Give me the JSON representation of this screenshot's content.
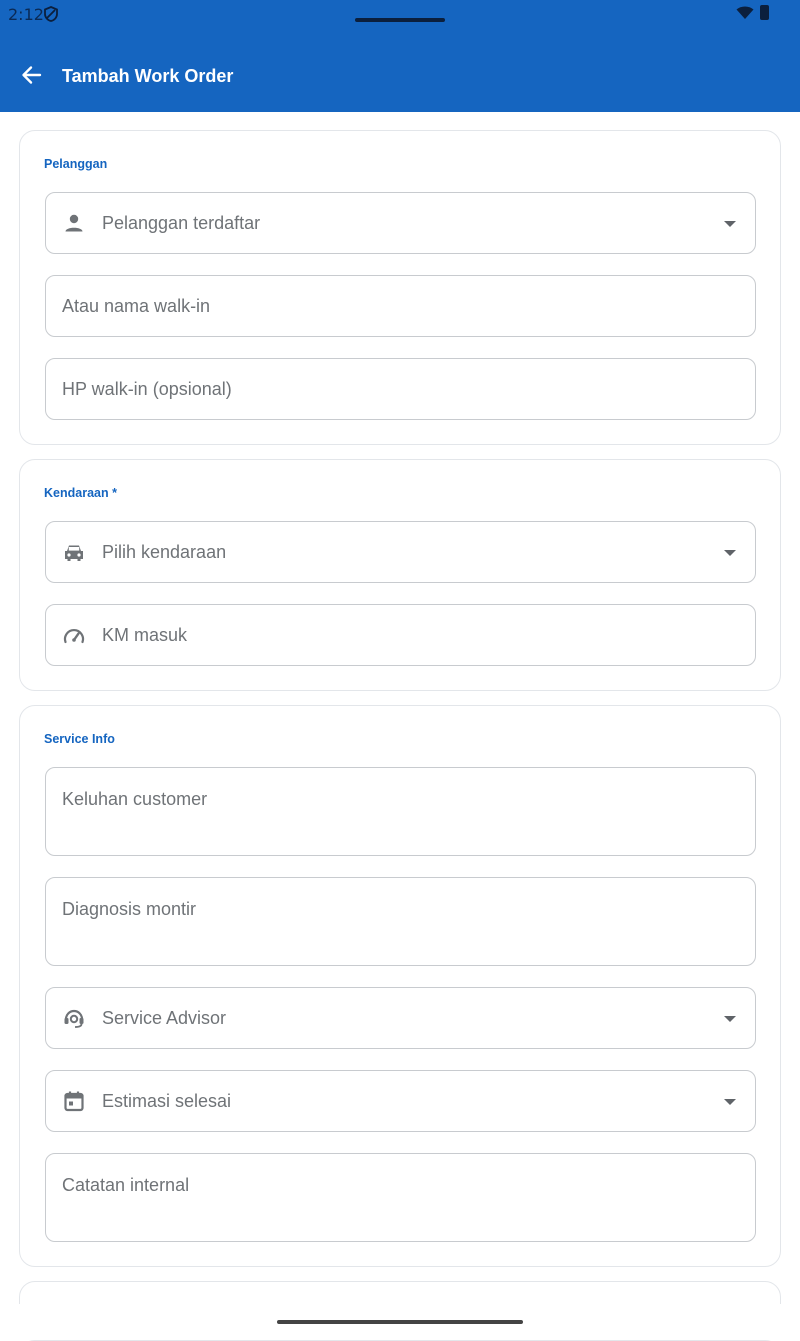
{
  "status_bar": {
    "time": "2:12"
  },
  "app_bar": {
    "title": "Tambah Work Order"
  },
  "sections": {
    "pelanggan": {
      "title": "Pelanggan",
      "registered_customer_placeholder": "Pelanggan terdaftar",
      "walkin_name_placeholder": "Atau nama walk-in",
      "walkin_phone_placeholder": "HP walk-in (opsional)"
    },
    "kendaraan": {
      "title": "Kendaraan *",
      "vehicle_placeholder": "Pilih kendaraan",
      "km_placeholder": "KM masuk"
    },
    "service_info": {
      "title": "Service Info",
      "complaint_placeholder": "Keluhan customer",
      "diagnosis_placeholder": "Diagnosis montir",
      "advisor_placeholder": "Service Advisor",
      "estimate_placeholder": "Estimasi selesai",
      "notes_placeholder": "Catatan internal"
    }
  },
  "colors": {
    "primary": "#1565c0",
    "border": "#c8cbcf",
    "placeholder": "#6f7377"
  }
}
